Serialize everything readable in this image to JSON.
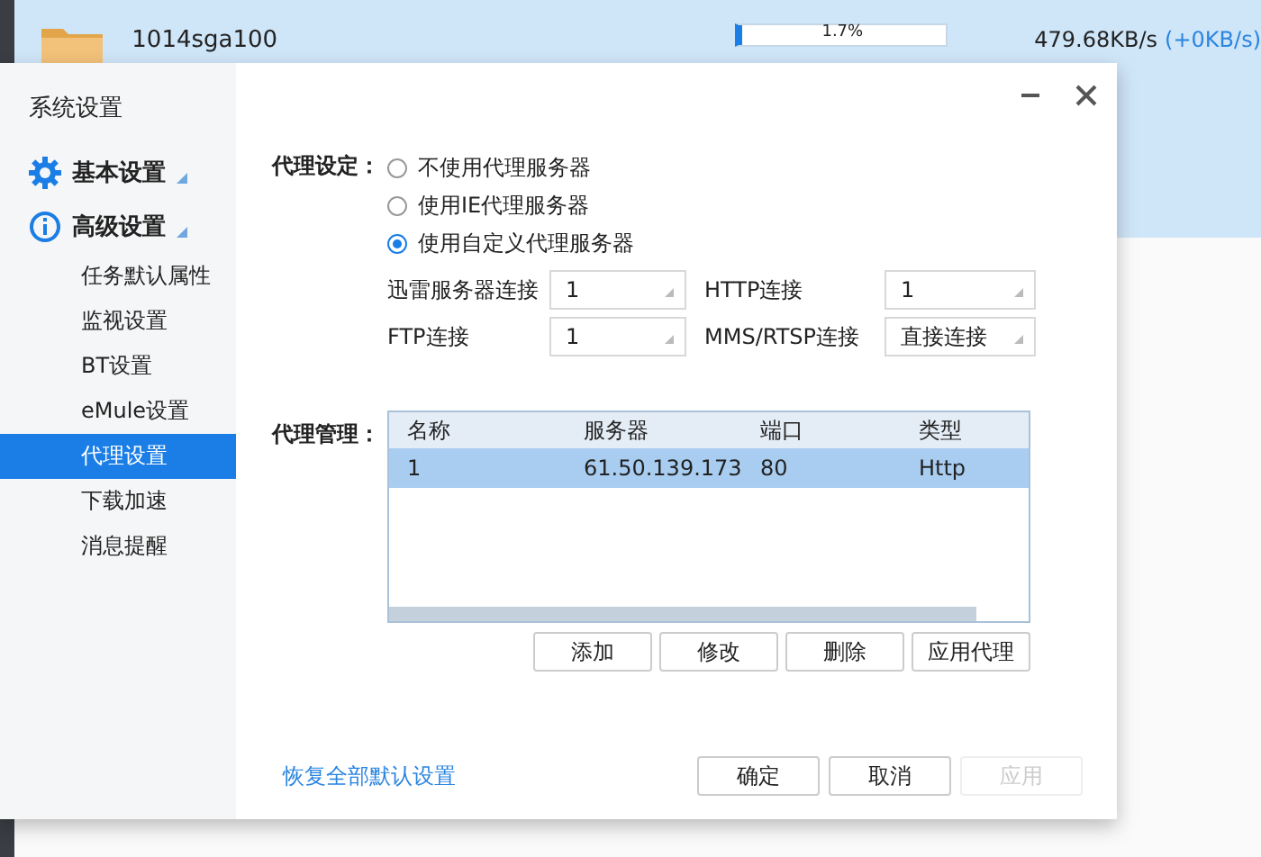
{
  "background_app": {
    "task": {
      "name": "1014sga100",
      "progress": {
        "level": 0.017,
        "reading": "1.7%"
      },
      "speed": "479.68KB/s",
      "speed_delta": "(+0KB/s)"
    }
  },
  "dialog": {
    "title": "系统设置",
    "sidebar": {
      "groups": [
        {
          "label": "基本设置"
        },
        {
          "label": "高级设置",
          "children": [
            {
              "label": "任务默认属性",
              "selected": false
            },
            {
              "label": "监视设置",
              "selected": false
            },
            {
              "label": "BT设置",
              "selected": false
            },
            {
              "label": "eMule设置",
              "selected": false
            },
            {
              "label": "代理设置",
              "selected": true
            },
            {
              "label": "下载加速",
              "selected": false
            },
            {
              "label": "消息提醒",
              "selected": false
            }
          ]
        }
      ]
    },
    "proxy_setting": {
      "label": "代理设定：",
      "options": [
        {
          "label": "不使用代理服务器",
          "selected": false
        },
        {
          "label": "使用IE代理服务器",
          "selected": false
        },
        {
          "label": "使用自定义代理服务器",
          "selected": true
        }
      ],
      "connections": [
        {
          "label": "迅雷服务器连接",
          "value": "1"
        },
        {
          "label": "HTTP连接",
          "value": "1"
        },
        {
          "label": "FTP连接",
          "value": "1"
        },
        {
          "label": "MMS/RTSP连接",
          "value": "直接连接"
        }
      ]
    },
    "proxy_management": {
      "label": "代理管理：",
      "columns": [
        "名称",
        "服务器",
        "端口",
        "类型"
      ],
      "rows": [
        {
          "cells": [
            "1",
            "61.50.139.173",
            "80",
            "Http"
          ],
          "selected": true
        }
      ],
      "buttons": [
        "添加",
        "修改",
        "删除",
        "应用代理"
      ]
    },
    "restore_link": "恢复全部默认设置",
    "buttons": [
      {
        "label": "确定",
        "disabled": false
      },
      {
        "label": "取消",
        "disabled": false
      },
      {
        "label": "应用",
        "disabled": true
      }
    ]
  }
}
